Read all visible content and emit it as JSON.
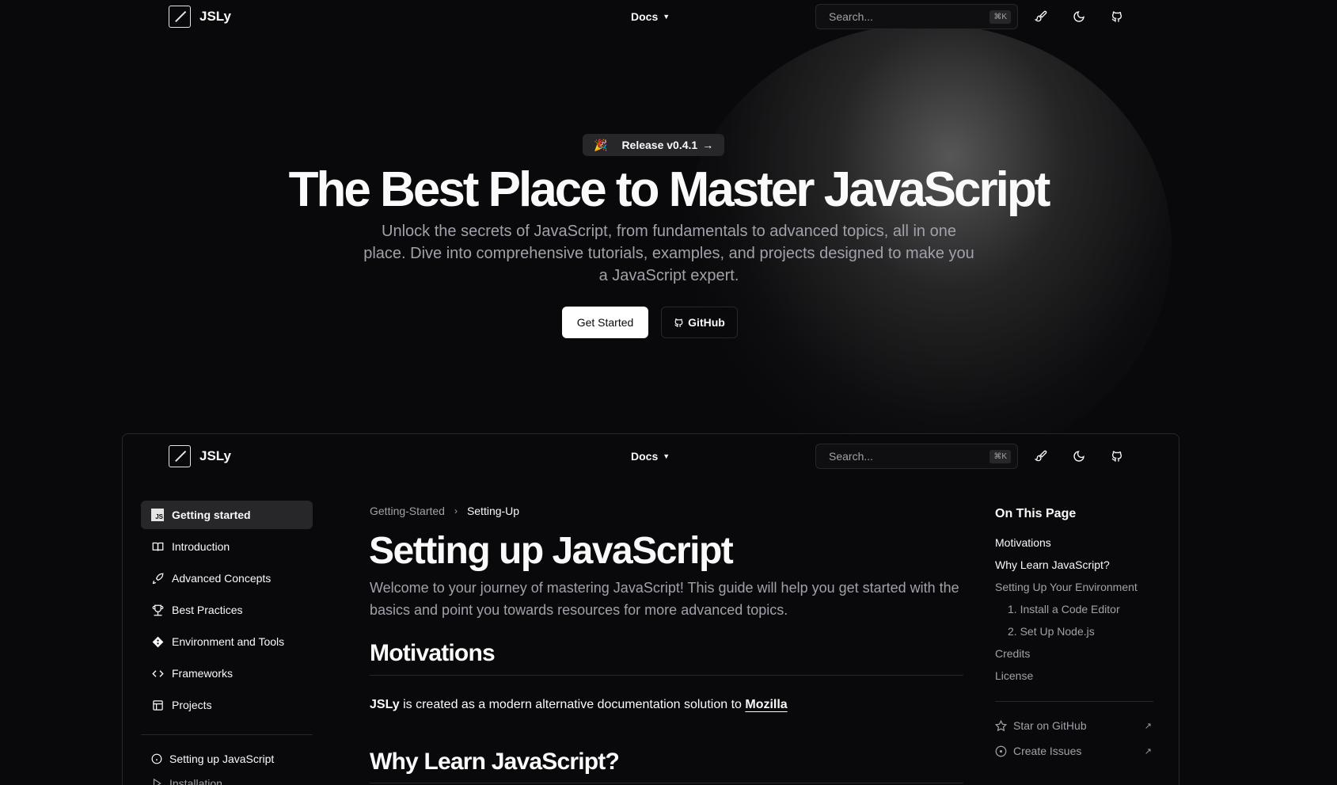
{
  "brand": {
    "name": "JSLy"
  },
  "nav": {
    "docs_label": "Docs",
    "search_placeholder": "Search...",
    "search_shortcut": "⌘K"
  },
  "hero": {
    "badge_emoji": "🎉",
    "badge_label": "Release v0.4.1",
    "title": "The Best Place to Master JavaScript",
    "subtitle": "Unlock the secrets of JavaScript, from fundamentals to advanced topics, all in one place. Dive into comprehensive tutorials, examples, and projects designed to make you a JavaScript expert.",
    "cta_primary": "Get Started",
    "cta_secondary": "GitHub"
  },
  "sidebar": {
    "items": [
      {
        "label": "Getting started",
        "icon": "js-icon",
        "active": true
      },
      {
        "label": "Introduction",
        "icon": "book-icon"
      },
      {
        "label": "Advanced Concepts",
        "icon": "rocket-icon"
      },
      {
        "label": "Best Practices",
        "icon": "trophy-icon"
      },
      {
        "label": "Environment and Tools",
        "icon": "git-icon"
      },
      {
        "label": "Frameworks",
        "icon": "code-icon"
      },
      {
        "label": "Projects",
        "icon": "layout-icon"
      }
    ],
    "sub_items": [
      {
        "label": "Setting up JavaScript",
        "icon": "info-icon"
      },
      {
        "label": "Installation",
        "icon": "play-icon"
      }
    ]
  },
  "doc": {
    "breadcrumbs": [
      "Getting-Started",
      "Setting-Up"
    ],
    "title": "Setting up JavaScript",
    "description": "Welcome to your journey of mastering JavaScript! This guide will help you get started with the basics and point you towards resources for more advanced topics.",
    "h2_motivations": "Motivations",
    "para_bold": "JSLy",
    "para_text": " is created as a modern alternative documentation solution to ",
    "para_link": "Mozilla",
    "h2_why": "Why Learn JavaScript?"
  },
  "toc": {
    "title": "On This Page",
    "items": [
      {
        "label": "Motivations"
      },
      {
        "label": "Why Learn JavaScript?",
        "current": true
      },
      {
        "label": "Setting Up Your Environment"
      },
      {
        "label": "1. Install a Code Editor",
        "indent": true
      },
      {
        "label": "2. Set Up Node.js",
        "indent": true
      },
      {
        "label": "Credits"
      },
      {
        "label": "License"
      }
    ],
    "links": [
      {
        "label": "Star on GitHub",
        "icon": "star-icon"
      },
      {
        "label": "Create Issues",
        "icon": "circle-dot-icon"
      }
    ],
    "external_arrow": "↗"
  }
}
